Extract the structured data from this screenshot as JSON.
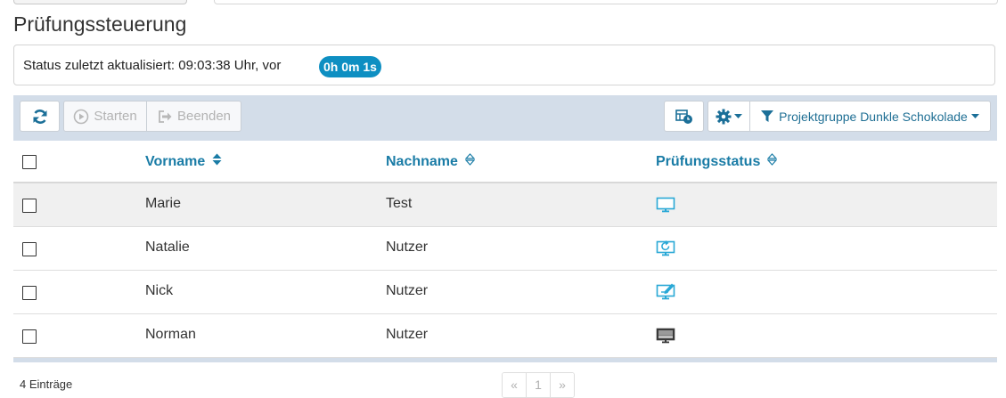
{
  "page": {
    "title": "Prüfungssteuerung"
  },
  "status": {
    "text": "Status zuletzt aktualisiert: 09:03:38 Uhr, vor",
    "elapsed": "0h 0m 1s"
  },
  "toolbar": {
    "start_label": "Starten",
    "stop_label": "Beenden",
    "filter_label": "Projektgruppe Dunkle Schokolade"
  },
  "table": {
    "columns": [
      "Vorname",
      "Nachname",
      "Prüfungsstatus"
    ],
    "rows": [
      {
        "vorname": "Marie",
        "nachname": "Test",
        "status_icon": "monitor-icon"
      },
      {
        "vorname": "Natalie",
        "nachname": "Nutzer",
        "status_icon": "monitor-refresh-icon"
      },
      {
        "vorname": "Nick",
        "nachname": "Nutzer",
        "status_icon": "monitor-edit-icon"
      },
      {
        "vorname": "Norman",
        "nachname": "Nutzer",
        "status_icon": "monitor-off-icon"
      }
    ]
  },
  "footer": {
    "entries": "4 Einträge"
  },
  "pagination": {
    "prev": "«",
    "page": "1",
    "next": "»"
  },
  "colors": {
    "accent": "#1a7ca6",
    "badge": "#0e8fc2",
    "toolbar_bg": "#d3dde9",
    "status_icon": "#29a8d6"
  }
}
